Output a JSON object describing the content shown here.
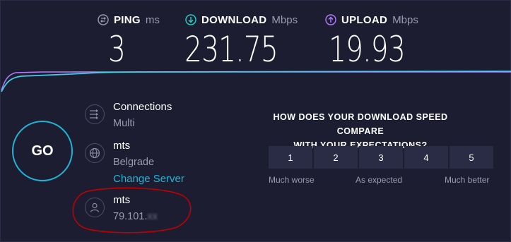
{
  "metrics": {
    "ping": {
      "label": "PING",
      "unit": "ms",
      "value": "3",
      "icon": "ping-icon"
    },
    "download": {
      "label": "DOWNLOAD",
      "unit": "Mbps",
      "value": "231.75",
      "icon": "download-icon",
      "color": "#1fd6c6"
    },
    "upload": {
      "label": "UPLOAD",
      "unit": "Mbps",
      "value": "19.93",
      "icon": "upload-icon",
      "color": "#b57cff"
    }
  },
  "go_button": {
    "label": "GO"
  },
  "connections": {
    "title": "Connections",
    "value": "Multi",
    "icon": "connections-icon"
  },
  "server": {
    "name": "mts",
    "location": "Belgrade",
    "change_label": "Change Server",
    "icon": "globe-icon"
  },
  "provider": {
    "name": "mts",
    "ip_visible": "79.101.",
    "ip_hidden": "xx",
    "icon": "user-icon"
  },
  "survey": {
    "question_line1": "HOW DOES YOUR DOWNLOAD SPEED COMPARE",
    "question_line2": "WITH YOUR EXPECTATIONS?",
    "options": [
      "1",
      "2",
      "3",
      "4",
      "5"
    ],
    "label_low": "Much worse",
    "label_mid": "As expected",
    "label_high": "Much better"
  },
  "colors": {
    "background": "#1c1d31",
    "accent": "#1fb4d6",
    "download_line": "#3fd0e6",
    "upload_line": "#b57cff",
    "annotation": "#c00000"
  }
}
